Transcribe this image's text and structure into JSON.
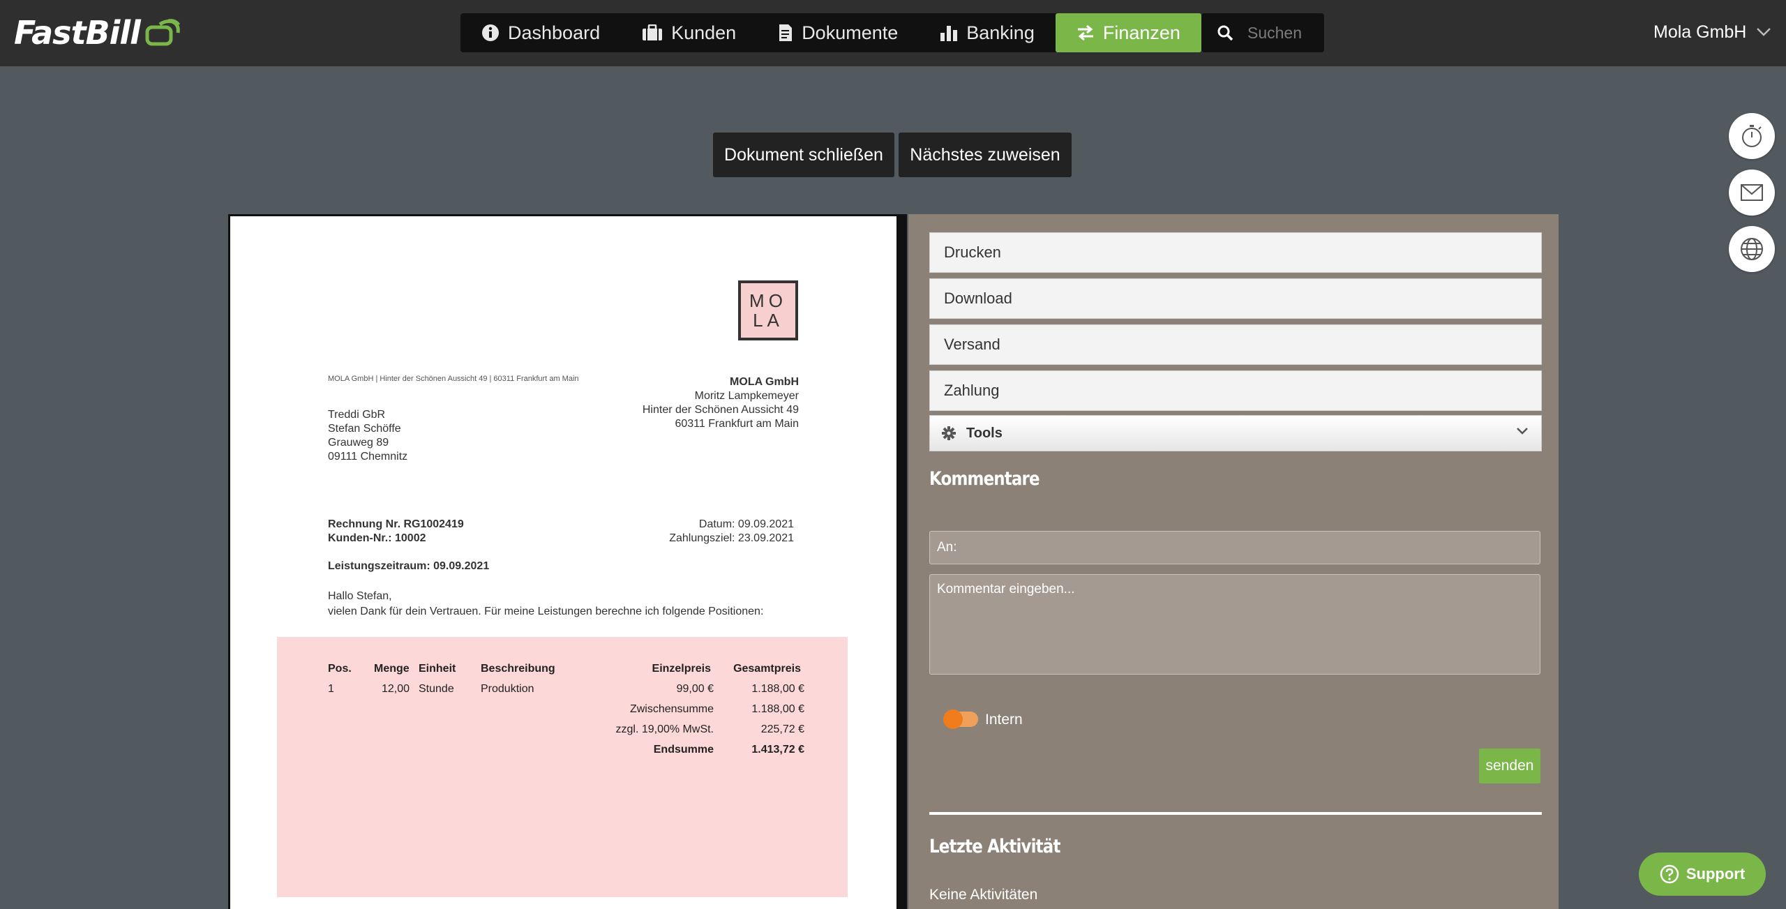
{
  "app": {
    "logo_text": "FastBill"
  },
  "nav": {
    "items": [
      {
        "label": "Dashboard",
        "icon": "info-icon"
      },
      {
        "label": "Kunden",
        "icon": "briefcase-icon"
      },
      {
        "label": "Dokumente",
        "icon": "document-icon"
      },
      {
        "label": "Banking",
        "icon": "bar-chart-icon"
      },
      {
        "label": "Finanzen",
        "icon": "exchange-icon",
        "active": true
      }
    ],
    "search_placeholder": "Suchen",
    "account_label": "Mola GmbH"
  },
  "actions": {
    "close_document": "Dokument schließen",
    "assign_next": "Nächstes zuweisen"
  },
  "floating": [
    "stopwatch-icon",
    "mail-icon",
    "globe-icon"
  ],
  "invoice": {
    "logo": [
      "MO",
      "LA"
    ],
    "sender_line": "MOLA GmbH | Hinter der Schönen Aussicht 49 | 60311 Frankfurt am Main",
    "recipient": [
      "Treddi GbR",
      "Stefan Schöffe",
      "Grauweg 89",
      "09111 Chemnitz"
    ],
    "issuer": {
      "company": "MOLA GmbH",
      "lines": [
        "Moritz Lampkemeyer",
        "Hinter der Schönen Aussicht 49",
        "60311 Frankfurt am Main"
      ]
    },
    "invoice_no": "Rechnung Nr. RG1002419",
    "customer_no": "Kunden-Nr.: 10002",
    "date": "Datum: 09.09.2021",
    "due": "Zahlungsziel: 23.09.2021",
    "service_period": "Leistungszeitraum: 09.09.2021",
    "greeting": "Hallo Stefan,",
    "intro": "vielen Dank für dein Vertrauen. Für meine Leistungen berechne ich folgende Positionen:",
    "table": {
      "headers": {
        "pos": "Pos.",
        "qty": "Menge",
        "unit": "Einheit",
        "desc": "Beschreibung",
        "price": "Einzelpreis",
        "total": "Gesamtpreis"
      },
      "row": {
        "pos": "1",
        "qty": "12,00",
        "unit": "Stunde",
        "desc": "Produktion",
        "price": "99,00 €",
        "total": "1.188,00 €"
      },
      "subtotal_label": "Zwischensumme",
      "subtotal_value": "1.188,00 €",
      "vat_label": "zzgl. 19,00% MwSt.",
      "vat_value": "225,72 €",
      "sum_label": "Endsumme",
      "sum_value": "1.413,72 €"
    }
  },
  "panel": {
    "buttons": [
      "Drucken",
      "Download",
      "Versand",
      "Zahlung"
    ],
    "tools_label": "Tools",
    "comments_title": "Kommentare",
    "to_placeholder": "An:",
    "comment_placeholder": "Kommentar eingeben...",
    "intern_label": "Intern",
    "send_label": "senden",
    "activity_title": "Letzte Aktivität",
    "no_activity": "Keine Aktivitäten"
  },
  "support_label": "Support",
  "colors": {
    "accent": "#7ab648",
    "topbar": "#2f2f2f",
    "panel": "#8c8177",
    "toggle": "#f07c1c"
  }
}
